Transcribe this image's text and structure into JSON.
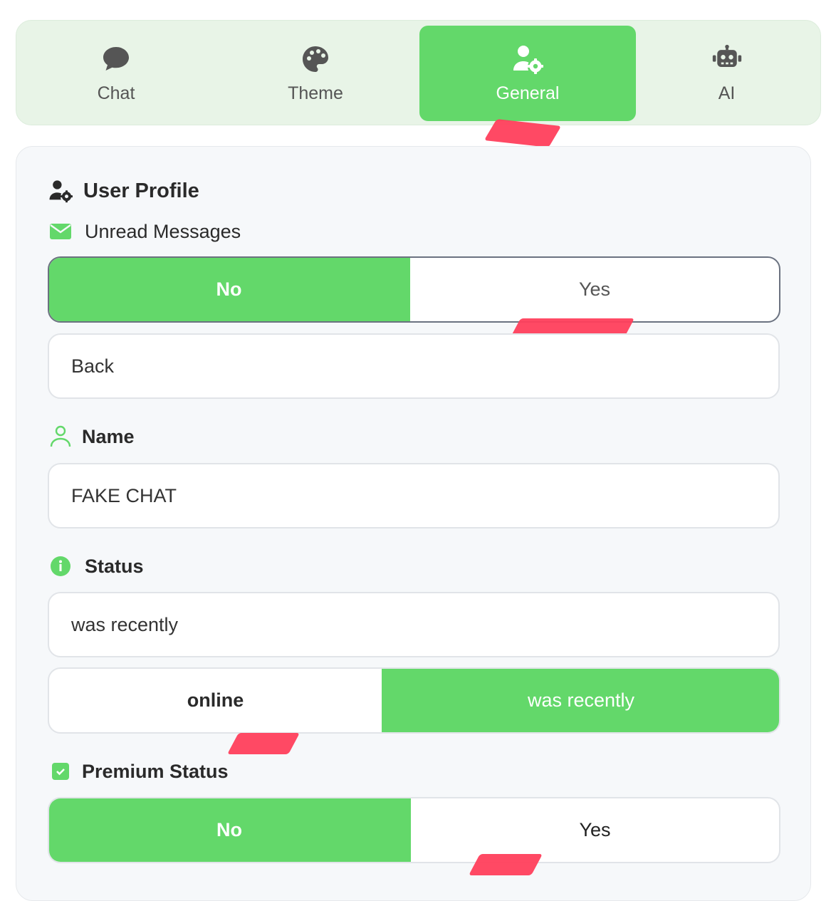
{
  "tabs": [
    {
      "label": "Chat",
      "icon": "chat-bubble-icon"
    },
    {
      "label": "Theme",
      "icon": "palette-icon"
    },
    {
      "label": "General",
      "icon": "user-gear-icon",
      "active": true
    },
    {
      "label": "AI",
      "icon": "robot-icon"
    }
  ],
  "user_profile": {
    "title": "User Profile",
    "unread_messages": {
      "label": "Unread Messages",
      "options": [
        "No",
        "Yes"
      ],
      "selected": "No",
      "value": "Back"
    },
    "name": {
      "label": "Name",
      "value": "FAKE CHAT"
    },
    "status": {
      "label": "Status",
      "value": "was recently",
      "options": [
        "online",
        "was recently"
      ],
      "selected": "was recently"
    },
    "premium_status": {
      "label": "Premium Status",
      "options": [
        "No",
        "Yes"
      ],
      "selected": "No"
    }
  },
  "colors": {
    "accent": "#63d86a",
    "tabbar_bg": "#e8f4e7",
    "panel_bg": "#f6f8fa",
    "highlight_mark": "#ff3f5c"
  }
}
